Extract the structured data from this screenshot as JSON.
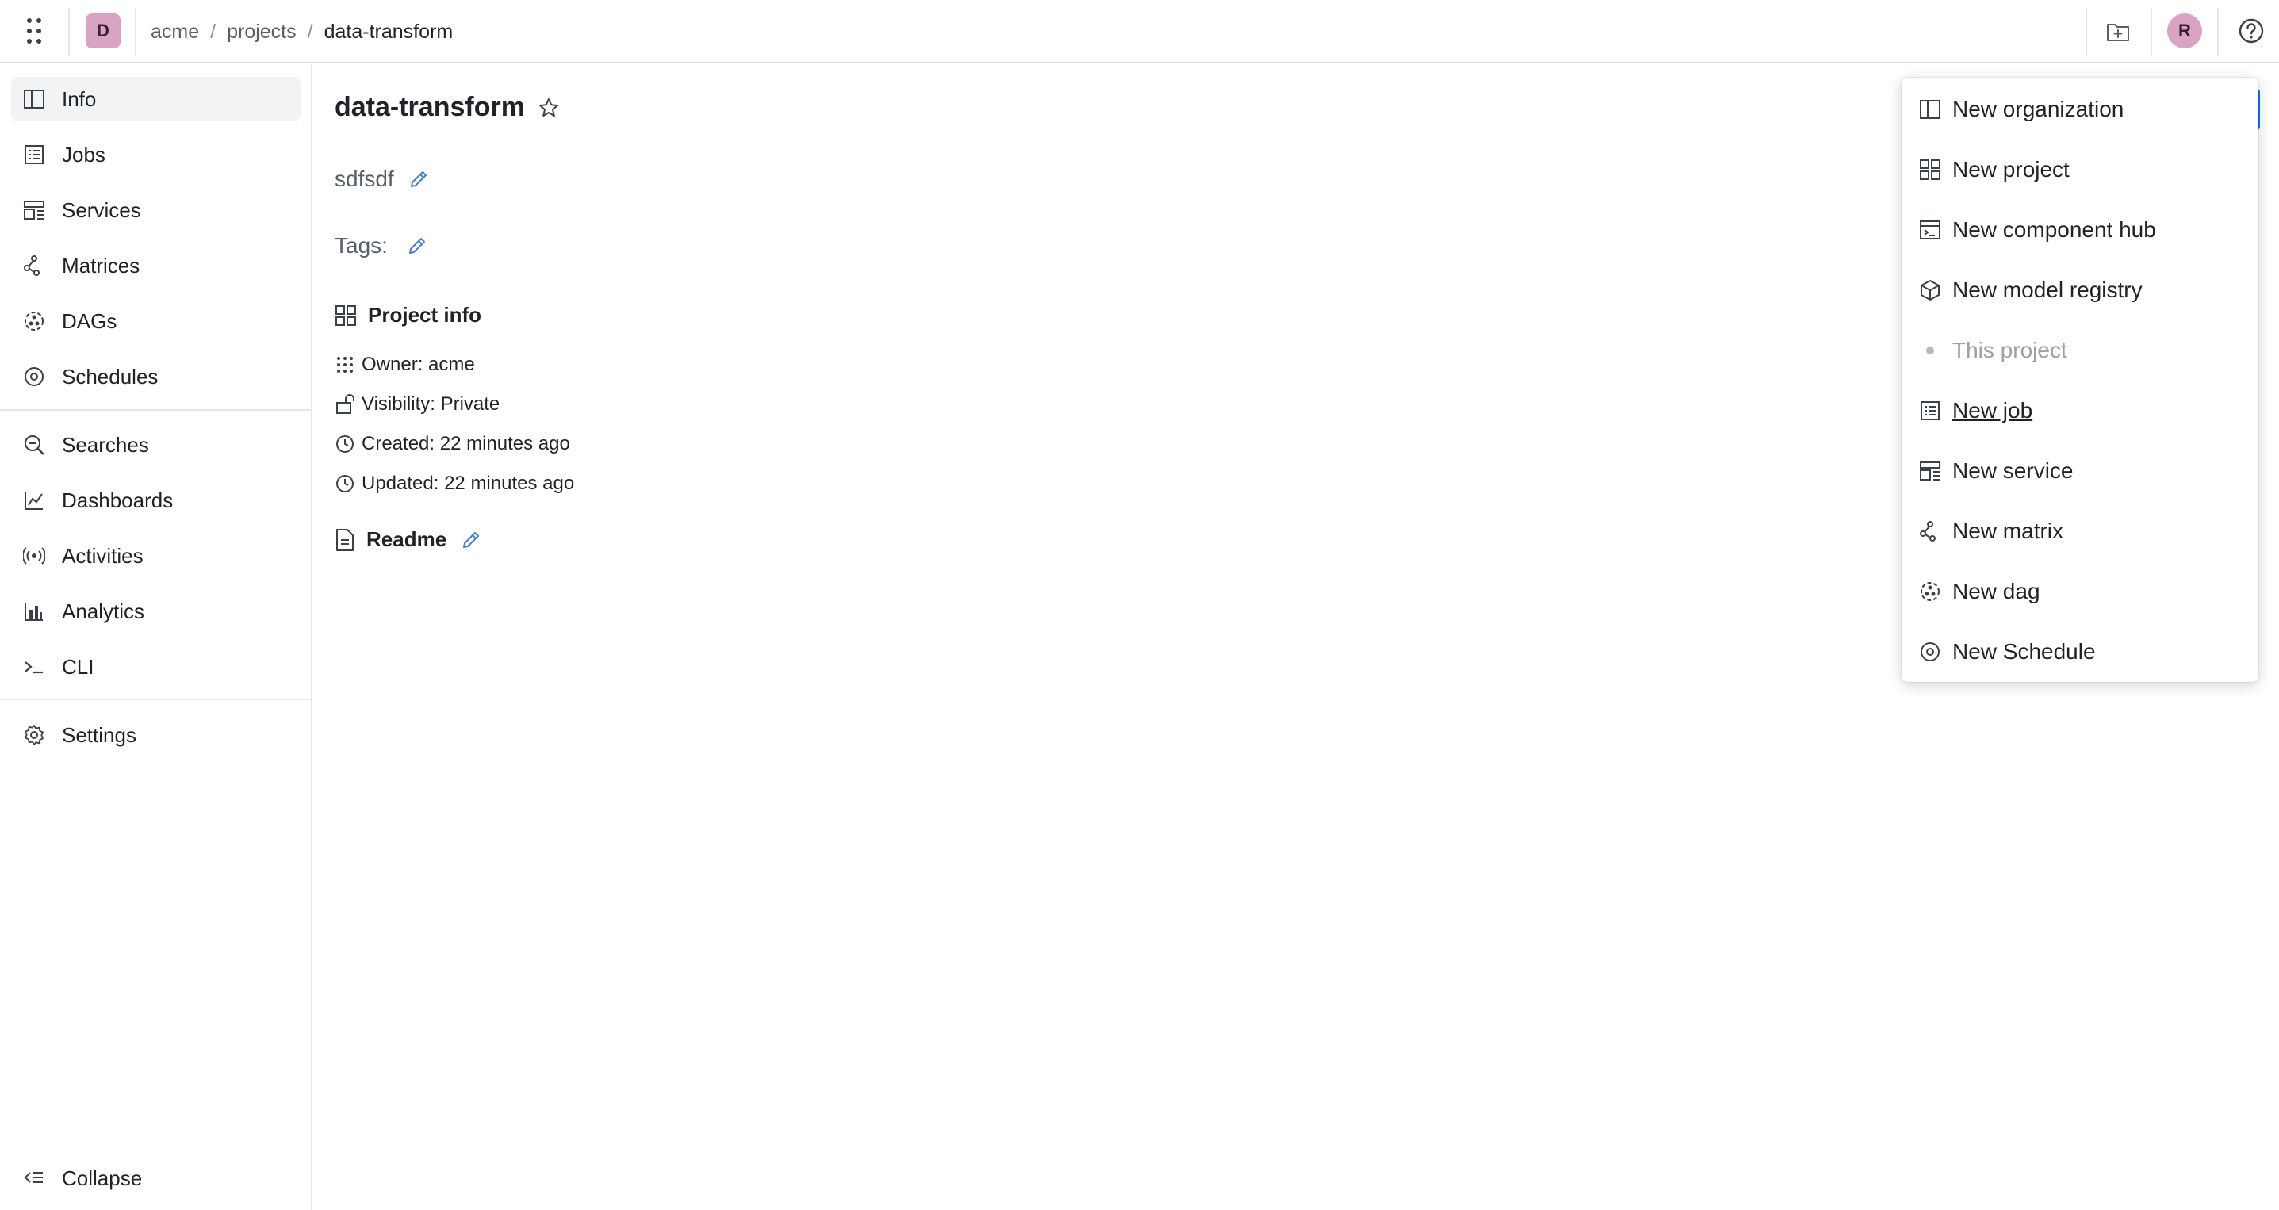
{
  "header": {
    "org_initial": "D",
    "breadcrumb": [
      {
        "label": "acme"
      },
      {
        "label": "projects"
      },
      {
        "label": "data-transform"
      }
    ],
    "breadcrumb_separator": "/",
    "user_initial": "R"
  },
  "sidebar": {
    "items": [
      {
        "label": "Info",
        "icon": "info-panel-icon",
        "active": true
      },
      {
        "label": "Jobs",
        "icon": "jobs-icon"
      },
      {
        "label": "Services",
        "icon": "services-icon"
      },
      {
        "label": "Matrices",
        "icon": "matrices-icon"
      },
      {
        "label": "DAGs",
        "icon": "dags-icon"
      },
      {
        "label": "Schedules",
        "icon": "schedules-icon"
      },
      {
        "label": "Searches",
        "icon": "searches-icon"
      },
      {
        "label": "Dashboards",
        "icon": "dashboards-icon"
      },
      {
        "label": "Activities",
        "icon": "activities-icon"
      },
      {
        "label": "Analytics",
        "icon": "analytics-icon"
      },
      {
        "label": "CLI",
        "icon": "cli-icon"
      },
      {
        "label": "Settings",
        "icon": "settings-icon"
      }
    ],
    "collapse_label": "Collapse"
  },
  "main": {
    "title": "data-transform",
    "description": "sdfsdf",
    "tags_label": "Tags:",
    "project_info_title": "Project info",
    "info": {
      "owner": "Owner: acme",
      "visibility": "Visibility: Private",
      "created": "Created: 22 minutes ago",
      "updated": "Updated: 22 minutes ago"
    },
    "readme_title": "Readme"
  },
  "menu": {
    "items": [
      {
        "label": "New organization",
        "icon": "organization-icon"
      },
      {
        "label": "New project",
        "icon": "project-icon"
      },
      {
        "label": "New component hub",
        "icon": "component-hub-icon"
      },
      {
        "label": "New model registry",
        "icon": "model-registry-icon"
      },
      {
        "label": "This project",
        "icon": "dot-icon",
        "disabled": true
      },
      {
        "label": "New job",
        "icon": "job-icon",
        "hover": true
      },
      {
        "label": "New service",
        "icon": "service-icon"
      },
      {
        "label": "New matrix",
        "icon": "matrix-icon"
      },
      {
        "label": "New dag",
        "icon": "dag-icon"
      },
      {
        "label": "New Schedule",
        "icon": "schedule-icon"
      }
    ]
  },
  "colors": {
    "accent": "#1f6feb",
    "avatar_bg": "#d9a3c4",
    "edit_icon": "#4a7fc1"
  }
}
